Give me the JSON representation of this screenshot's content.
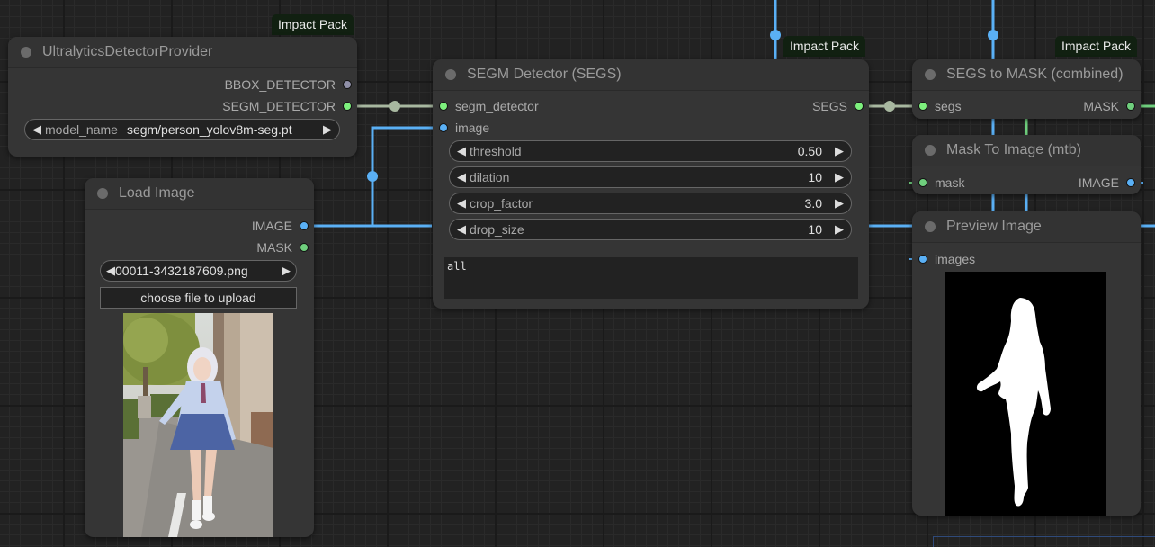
{
  "colors": {
    "segs_link": "#a8b8a0",
    "image_link": "#5ab0f5",
    "mask_link": "#6fcf7d",
    "badge_bg": "#112011"
  },
  "nodes": {
    "ultralytics": {
      "badge": "Impact Pack",
      "title": "UltralyticsDetectorProvider",
      "outputs": [
        "BBOX_DETECTOR",
        "SEGM_DETECTOR"
      ],
      "widgets": [
        {
          "label": "model_name",
          "value": "segm/person_yolov8m-seg.pt"
        }
      ]
    },
    "load_image": {
      "title": "Load Image",
      "outputs": [
        "IMAGE",
        "MASK"
      ],
      "widgets": [
        {
          "label": "image",
          "value": "00011-3432187609.png"
        }
      ],
      "upload_button": "choose file to upload",
      "preview_description": "photo of a girl in school uniform walking on a sidewalk"
    },
    "segm_detector": {
      "badge": "Impact Pack",
      "title": "SEGM Detector (SEGS)",
      "inputs": [
        "segm_detector",
        "image"
      ],
      "outputs": [
        "SEGS"
      ],
      "widgets": [
        {
          "label": "threshold",
          "value": "0.50"
        },
        {
          "label": "dilation",
          "value": "10"
        },
        {
          "label": "crop_factor",
          "value": "3.0"
        },
        {
          "label": "drop_size",
          "value": "10"
        }
      ],
      "labels_text": "all"
    },
    "segs_to_mask": {
      "badge": "Impact Pack",
      "title": "SEGS to MASK (combined)",
      "inputs": [
        "segs"
      ],
      "outputs": [
        "MASK"
      ]
    },
    "mask_to_image": {
      "title": "Mask To Image (mtb)",
      "inputs": [
        "mask"
      ],
      "outputs": [
        "IMAGE"
      ]
    },
    "preview_image": {
      "title": "Preview Image",
      "inputs": [
        "images"
      ],
      "preview_description": "white silhouette mask of a person on black background"
    }
  },
  "icons": {
    "arrow_left": "◀",
    "arrow_right": "▶"
  }
}
